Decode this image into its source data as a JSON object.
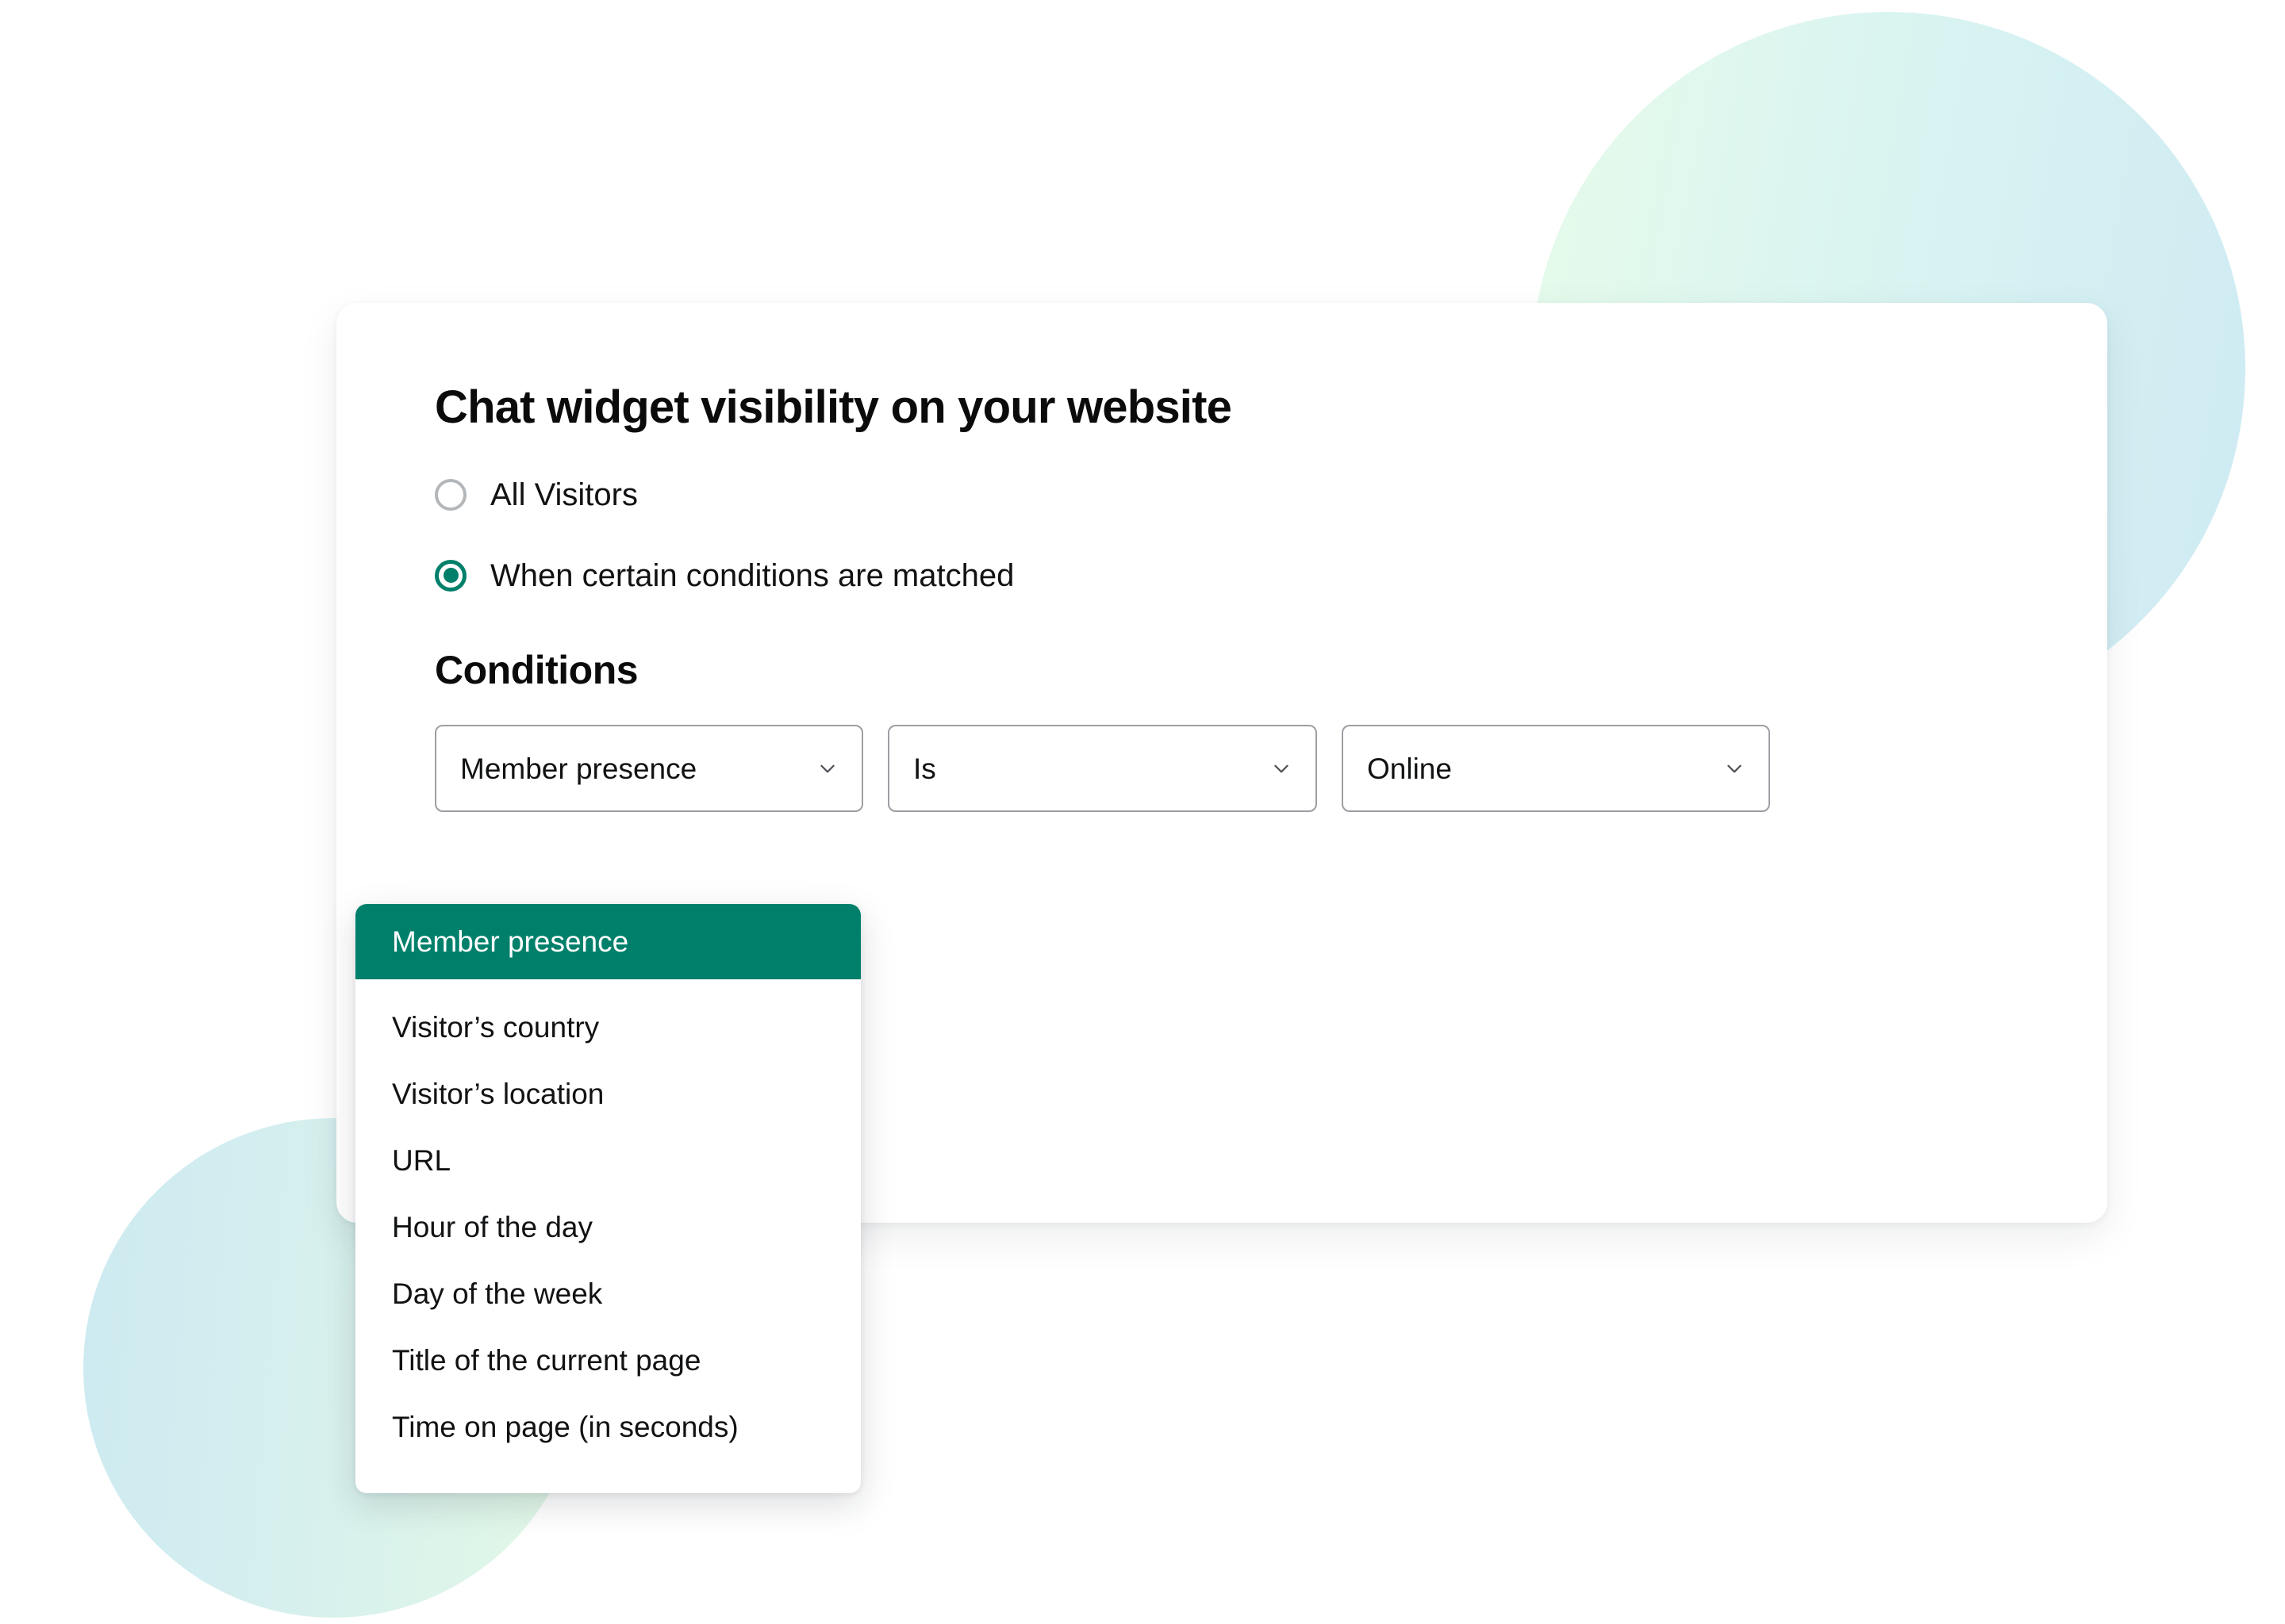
{
  "card": {
    "title": "Chat widget visibility on your website",
    "visibility_options": [
      {
        "label": "All Visitors",
        "selected": false
      },
      {
        "label": "When certain conditions are matched",
        "selected": true
      }
    ],
    "conditions": {
      "heading": "Conditions",
      "selects": [
        {
          "name": "field",
          "value": "Member presence",
          "icon": "chevron-down-icon"
        },
        {
          "name": "operator",
          "value": "Is",
          "icon": "chevron-down-icon"
        },
        {
          "name": "value",
          "value": "Online",
          "icon": "chevron-down-icon"
        }
      ]
    }
  },
  "dropdown": {
    "open_for": "field",
    "items": [
      {
        "label": "Member presence",
        "highlighted": true
      },
      {
        "label": "Visitor’s country",
        "highlighted": false
      },
      {
        "label": "Visitor’s location",
        "highlighted": false
      },
      {
        "label": "URL",
        "highlighted": false
      },
      {
        "label": "Hour of the day",
        "highlighted": false
      },
      {
        "label": "Day of the week",
        "highlighted": false
      },
      {
        "label": "Title of the current page",
        "highlighted": false
      },
      {
        "label": "Time on page (in seconds)",
        "highlighted": false
      }
    ]
  },
  "colors": {
    "accent_green": "#00806b",
    "text_primary": "#111214",
    "border_grey": "#9c9fa3",
    "radio_unselected": "#b4b7ba",
    "background": "#ffffff"
  }
}
